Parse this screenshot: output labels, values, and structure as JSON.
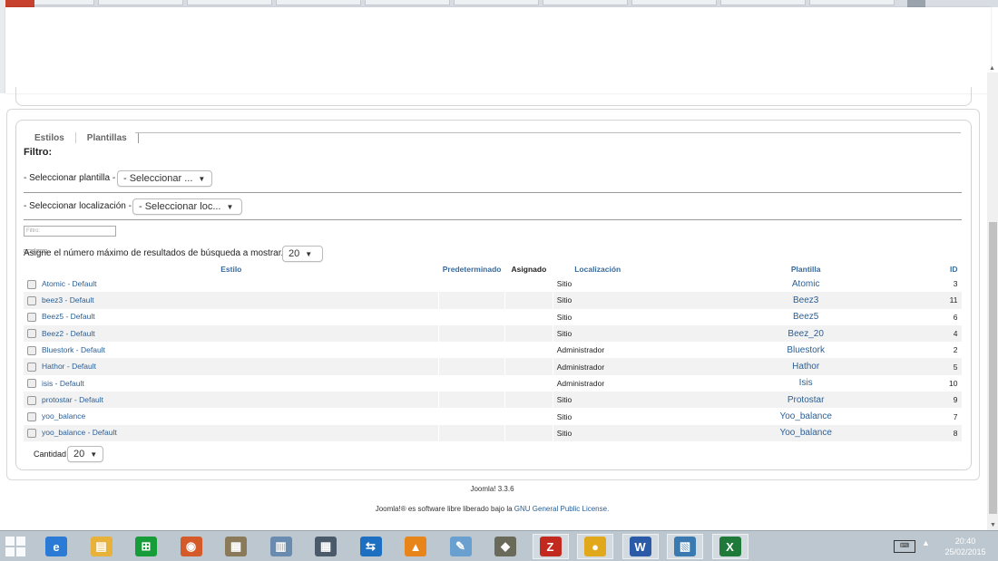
{
  "tabs": {
    "estilos": "Estilos",
    "plantillas": "Plantillas"
  },
  "filter": {
    "title": "Filtro:",
    "template_label": "- Seleccionar plantilla -",
    "template_select": "- Seleccionar ...",
    "location_label": "- Seleccionar localización -",
    "location_select": "- Seleccionar loc...",
    "search_placeholder": "Filtro:",
    "max_results_label": "Asigne el número máximo de resultados de búsqueda a mostrar.",
    "max_results_value": "20"
  },
  "table": {
    "headers": {
      "estilo": "Estilo",
      "predeterminado": "Predeterminado",
      "asignado": "Asignado",
      "localizacion": "Localización",
      "plantilla": "Plantilla",
      "id": "ID"
    },
    "rows": [
      {
        "name": "Atomic - Default",
        "location": "Sitio",
        "template": "Atomic",
        "id": "3"
      },
      {
        "name": "beez3 - Default",
        "location": "Sitio",
        "template": "Beez3",
        "id": "11"
      },
      {
        "name": "Beez5 - Default",
        "location": "Sitio",
        "template": "Beez5",
        "id": "6"
      },
      {
        "name": "Beez2 - Default",
        "location": "Sitio",
        "template": "Beez_20",
        "id": "4"
      },
      {
        "name": "Bluestork - Default",
        "location": "Administrador",
        "template": "Bluestork",
        "id": "2"
      },
      {
        "name": "Hathor - Default",
        "location": "Administrador",
        "template": "Hathor",
        "id": "5"
      },
      {
        "name": "isis - Default",
        "location": "Administrador",
        "template": "Isis",
        "id": "10"
      },
      {
        "name": "protostar - Default",
        "location": "Sitio",
        "template": "Protostar",
        "id": "9"
      },
      {
        "name": "yoo_balance",
        "location": "Sitio",
        "template": "Yoo_balance",
        "id": "7"
      },
      {
        "name": "yoo_balance - Default",
        "location": "Sitio",
        "template": "Yoo_balance",
        "id": "8"
      }
    ]
  },
  "pagination": {
    "label": "Cantidad",
    "value": "20"
  },
  "footer": {
    "version": "Joomla! 3.3.6",
    "license_prefix": "Joomla!® es software libre liberado bajo la",
    "license_link": "GNU General Public License."
  },
  "taskbar": {
    "apps": [
      {
        "icon": "internet-explorer-icon",
        "color": "#2b7bd6"
      },
      {
        "icon": "file-explorer-icon",
        "color": "#e8b13a"
      },
      {
        "icon": "store-icon",
        "color": "#179c3a"
      },
      {
        "icon": "picasa-icon",
        "color": "#d45a2a"
      },
      {
        "icon": "photo-viewer-icon",
        "color": "#8a7a5a"
      },
      {
        "icon": "calculator-icon",
        "color": "#6a8bb0"
      },
      {
        "icon": "movie-maker-icon",
        "color": "#4a5a6a"
      },
      {
        "icon": "teamviewer-icon",
        "color": "#1d6fc2"
      },
      {
        "icon": "vlc-icon",
        "color": "#e8851a"
      },
      {
        "icon": "paint-icon",
        "color": "#6aa0d0"
      },
      {
        "icon": "gimp-icon",
        "color": "#6a6a5a"
      },
      {
        "icon": "filezilla-icon",
        "color": "#c22a1f"
      },
      {
        "icon": "chrome-icon",
        "color": "#e0a81a"
      },
      {
        "icon": "word-icon",
        "color": "#2a5aa8"
      },
      {
        "icon": "image-viewer-icon",
        "color": "#3a7ab0"
      },
      {
        "icon": "excel-icon",
        "color": "#1f7a3a"
      }
    ],
    "clock_time": "20:40",
    "clock_date": "25/02/2015"
  }
}
